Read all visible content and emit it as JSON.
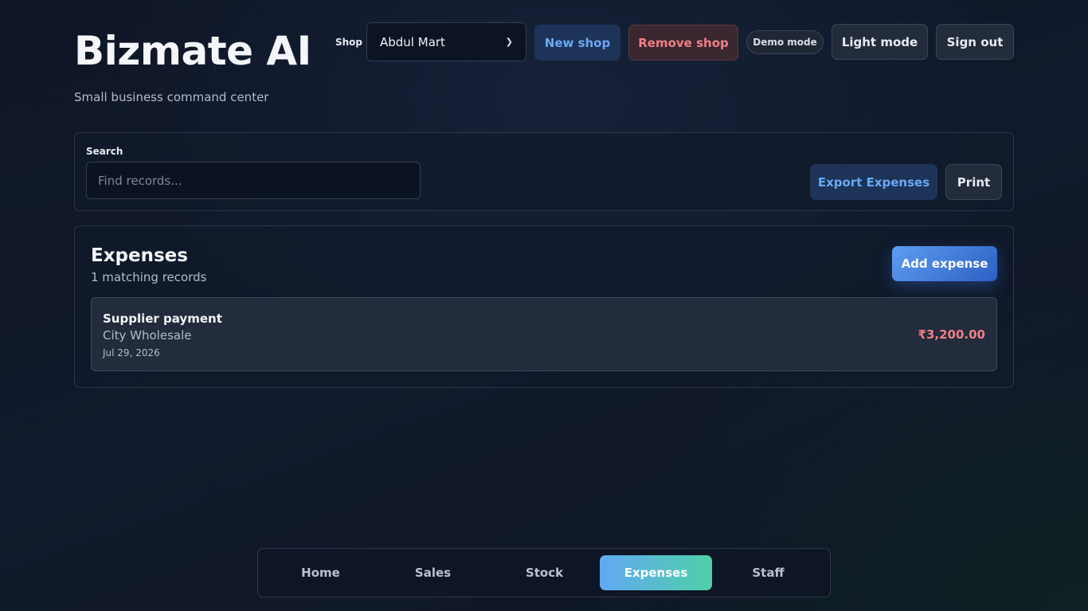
{
  "header": {
    "title": "Bizmate AI",
    "subtitle": "Small business command center",
    "shop_label": "Shop",
    "shop_selected": "Abdul Mart",
    "new_shop_label": "New shop",
    "remove_shop_label": "Remove shop",
    "demo_mode_label": "Demo mode",
    "light_mode_label": "Light mode",
    "sign_out_label": "Sign out"
  },
  "search": {
    "label": "Search",
    "placeholder": "Find records...",
    "value": "",
    "export_label": "Export Expenses",
    "print_label": "Print"
  },
  "expenses": {
    "title": "Expenses",
    "count_text": "1 matching records",
    "add_label": "Add expense",
    "items": [
      {
        "title": "Supplier payment",
        "vendor": "City Wholesale",
        "date": "Jul 29, 2026",
        "amount": "₹3,200.00"
      }
    ]
  },
  "nav": {
    "tabs": [
      {
        "label": "Home"
      },
      {
        "label": "Sales"
      },
      {
        "label": "Stock"
      },
      {
        "label": "Expenses"
      },
      {
        "label": "Staff"
      }
    ],
    "active": "Expenses"
  },
  "colors": {
    "accent_blue": "#6aa8f5",
    "danger_red": "#f07f86",
    "active_tab_gradient_start": "#62a8f4",
    "active_tab_gradient_end": "#4fd0a6"
  }
}
